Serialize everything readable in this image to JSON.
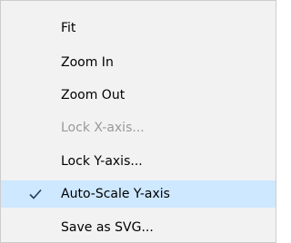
{
  "menu": {
    "items": [
      {
        "label": "Fit",
        "enabled": true,
        "checked": false
      },
      {
        "label": "Zoom In",
        "enabled": true,
        "checked": false
      },
      {
        "label": "Zoom Out",
        "enabled": true,
        "checked": false
      },
      {
        "label": "Lock X-axis...",
        "enabled": false,
        "checked": false
      },
      {
        "label": "Lock Y-axis...",
        "enabled": true,
        "checked": false
      },
      {
        "label": "Auto-Scale Y-axis",
        "enabled": true,
        "checked": true
      },
      {
        "label": "Save as SVG...",
        "enabled": true,
        "checked": false
      }
    ]
  },
  "colors": {
    "menu_background": "#f2f2f2",
    "menu_border": "#cccccc",
    "checked_highlight": "#cde8ff",
    "disabled_text": "#9a9a9a",
    "check_mark": "#1f3b57"
  },
  "icons": {
    "check": "check-icon"
  }
}
